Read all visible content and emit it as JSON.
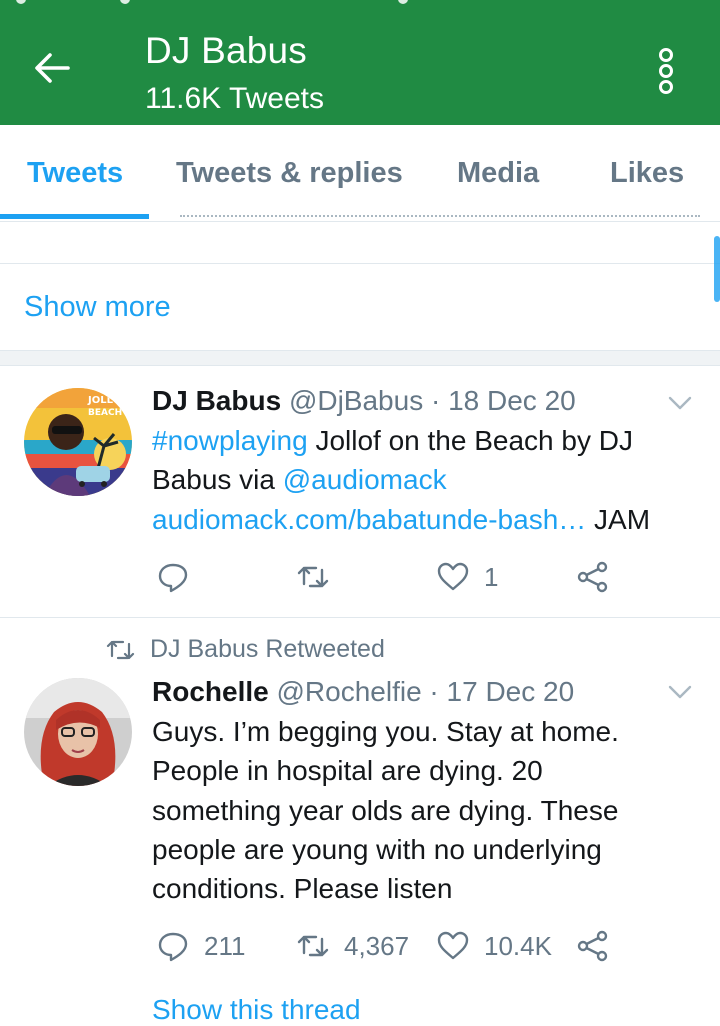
{
  "header": {
    "title": "DJ Babus",
    "subtitle": "11.6K Tweets",
    "background": "#208b43"
  },
  "tabs": [
    {
      "label": "Tweets",
      "active": true
    },
    {
      "label": "Tweets & replies",
      "active": false
    },
    {
      "label": "Media",
      "active": false
    },
    {
      "label": "Likes",
      "active": false
    }
  ],
  "show_more": "Show more",
  "tweets": [
    {
      "name": "DJ Babus",
      "handle": "@DjBabus",
      "separator": "·",
      "date": "18 Dec 20",
      "text": {
        "hashtag": "#nowplaying",
        "t1": " Jollof on the Beach by DJ Babus via ",
        "mention": "@audiomack",
        "newline_link": "audiomack.com/babatunde-bash…",
        "t2": " JAM"
      },
      "avatar_text": [
        "JOLL",
        "BEACH"
      ],
      "stats": {
        "replies": "",
        "retweets": "",
        "likes": "1"
      }
    },
    {
      "retweeted_by": "DJ Babus Retweeted",
      "name": "Rochelle",
      "handle": "@Rochelfie",
      "separator": "·",
      "date": "17 Dec 20",
      "text": "Guys. I’m begging you. Stay at home. People in hospital are dying. 20 something year olds are dying. These people are young with no underlying conditions. Please listen",
      "stats": {
        "replies": "211",
        "retweets": "4,367",
        "likes": "10.4K"
      }
    }
  ],
  "cutoff_link": "Show this thread",
  "accent": "#1da1f2",
  "icons": [
    "back-arrow-icon",
    "more-vert-icon",
    "chevron-down-icon",
    "reply-icon",
    "retweet-icon",
    "heart-icon",
    "share-icon"
  ]
}
